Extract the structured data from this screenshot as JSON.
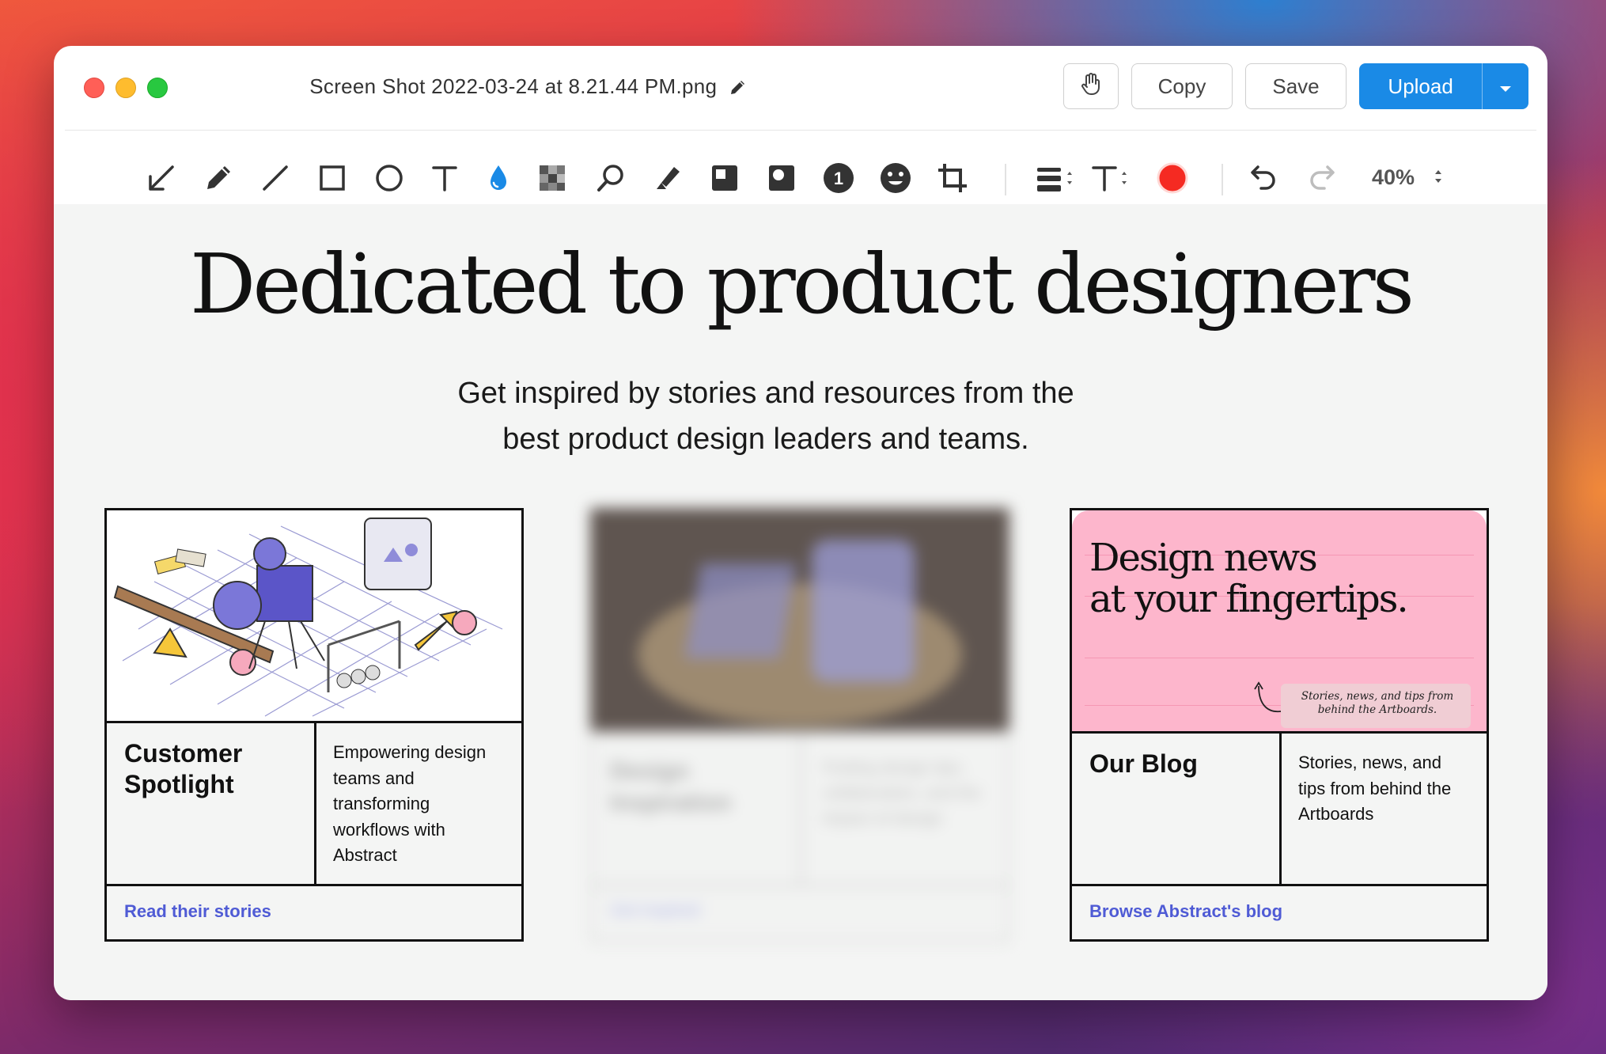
{
  "window": {
    "title": "Screen Shot 2022-03-24 at 8.21.44 PM.png",
    "buttons": {
      "copy": "Copy",
      "save": "Save",
      "upload": "Upload"
    }
  },
  "toolbar": {
    "tools": [
      "arrow-icon",
      "pencil-icon",
      "line-icon",
      "rectangle-icon",
      "ellipse-icon",
      "text-icon",
      "highlighter-drop-icon",
      "pixelate-icon",
      "magnifier-icon",
      "marker-icon",
      "filled-rectangle-icon",
      "spotlight-icon",
      "counter-icon",
      "emoji-icon",
      "crop-icon",
      "line-weight-icon",
      "font-size-icon",
      "color-picker-icon",
      "undo-icon",
      "redo-icon"
    ],
    "counter_value": "1",
    "zoom": "40%",
    "active_color": "#f52a22",
    "accent_color": "#1a8ae6"
  },
  "page": {
    "headline": "Dedicated to product designers",
    "subhead_line1": "Get inspired by stories and resources from the",
    "subhead_line2": "best product design leaders and teams.",
    "cards": [
      {
        "title": "Customer Spotlight",
        "description": "Empowering design teams and transforming workflows with Abstract",
        "link": "Read their stories"
      },
      {
        "title": "Design Inspiration",
        "description": "Finding design tips, collaboration, and the impact of design",
        "link": "Get inspired"
      },
      {
        "title": "Our Blog",
        "description": "Stories, news, and tips from behind the Artboards",
        "link": "Browse Abstract's blog",
        "image_title_line1": "Design news",
        "image_title_line2": "at your fingertips.",
        "image_note": "Stories, news, and tips from behind the Artboards."
      }
    ]
  }
}
